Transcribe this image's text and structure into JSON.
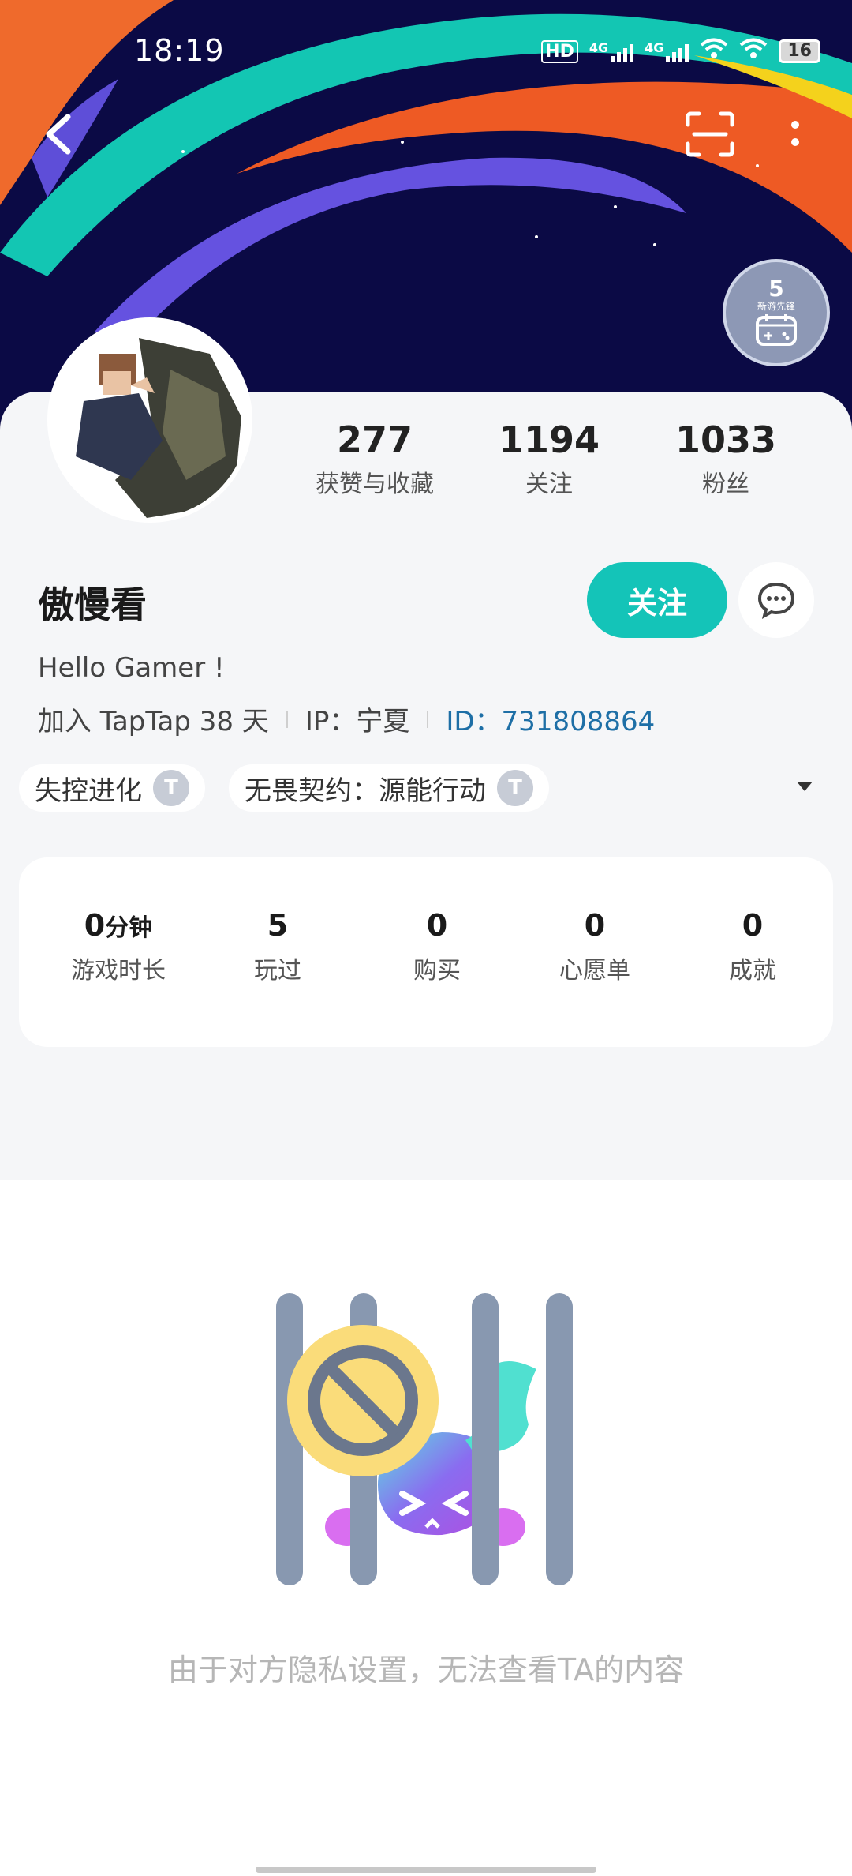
{
  "status_bar": {
    "time": "18:19",
    "hd": "HD",
    "net1": "4G",
    "net2": "4G",
    "battery": "16",
    "icons": [
      "hd-icon",
      "signal-icon",
      "signal-icon",
      "wifi-icon",
      "wifi-icon",
      "battery-icon"
    ]
  },
  "nav": {
    "back_icon": "back-arrow-icon",
    "scan_icon": "scan-icon",
    "more_icon": "more-vertical-icon"
  },
  "badge": {
    "count": "5",
    "label": "新游先锋",
    "icon": "gamepad-calendar-icon"
  },
  "profile": {
    "stats": [
      {
        "value": "277",
        "label": "获赞与收藏"
      },
      {
        "value": "1194",
        "label": "关注"
      },
      {
        "value": "1033",
        "label": "粉丝"
      }
    ],
    "username": "傲慢看",
    "follow_label": "关注",
    "message_icon": "message-icon",
    "bio": "Hello Gamer !",
    "joined": "加入 TapTap 38 天",
    "ip": "IP：宁夏",
    "id": "ID：731808864"
  },
  "tags": [
    {
      "label": "失控进化",
      "icon_text": "T"
    },
    {
      "label": "无畏契约：源能行动",
      "icon_text": "T"
    }
  ],
  "game_stats": [
    {
      "value": "0",
      "unit": "分钟",
      "label": "游戏时长"
    },
    {
      "value": "5",
      "label": "玩过"
    },
    {
      "value": "0",
      "label": "购买"
    },
    {
      "value": "0",
      "label": "心愿单"
    },
    {
      "value": "0",
      "label": "成就"
    }
  ],
  "private": {
    "message": "由于对方隐私设置，无法查看TA的内容",
    "illustration_icon": "private-jail-icon"
  },
  "colors": {
    "accent": "#14c4b8",
    "id_link": "#1e6fa6",
    "banner_bg": "#0b0a45"
  }
}
